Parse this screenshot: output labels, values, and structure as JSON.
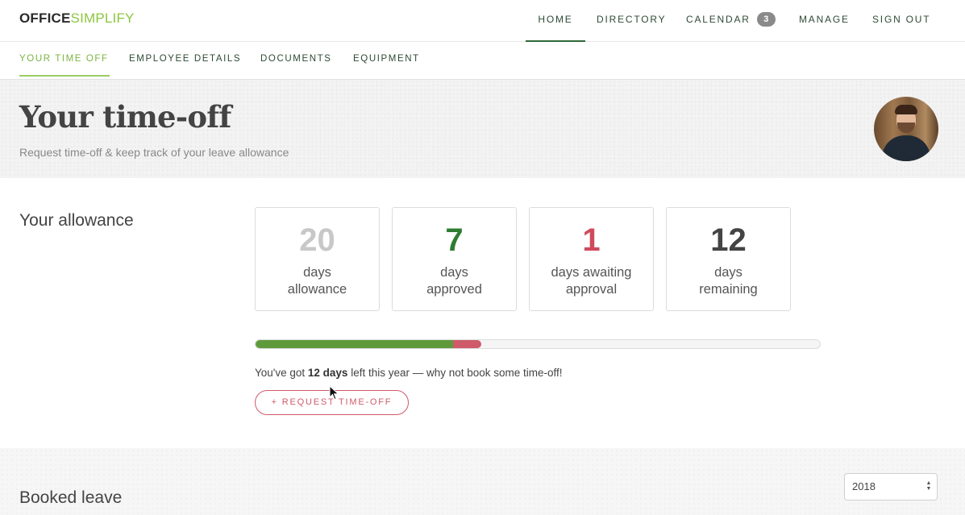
{
  "brand": {
    "part1": "OFFICE",
    "part2": "SIMPLIFY"
  },
  "main_nav": [
    {
      "label": "HOME",
      "active": true
    },
    {
      "label": "DIRECTORY"
    },
    {
      "label": "CALENDAR",
      "badge": "3"
    },
    {
      "label": "MANAGE"
    },
    {
      "label": "SIGN OUT"
    }
  ],
  "sub_nav": [
    {
      "label": "YOUR TIME OFF",
      "active": true
    },
    {
      "label": "EMPLOYEE DETAILS"
    },
    {
      "label": "DOCUMENTS"
    },
    {
      "label": "EQUIPMENT"
    }
  ],
  "header": {
    "title": "Your time-off",
    "subtitle": "Request time-off & keep track of your leave allowance"
  },
  "allowance": {
    "title": "Your allowance",
    "cards": [
      {
        "value": "20",
        "line1": "days",
        "line2": "allowance",
        "color": "#c8c8c8"
      },
      {
        "value": "7",
        "line1": "days",
        "line2": "approved",
        "color": "#2e7d32"
      },
      {
        "value": "1",
        "line1": "days awaiting",
        "line2": "approval",
        "color": "#d04a5c"
      },
      {
        "value": "12",
        "line1": "days",
        "line2": "remaining",
        "color": "#444444"
      }
    ],
    "progress": {
      "approved_fraction": 0.35,
      "pending_fraction": 0.05
    },
    "message_prefix": "You've got ",
    "message_bold": "12 days",
    "message_suffix": " left this year — why not book some time-off!",
    "request_button": "+ REQUEST TIME-OFF"
  },
  "booked": {
    "title": "Booked leave",
    "year": "2018"
  },
  "colors": {
    "brand_green": "#8cc63f",
    "nav_text": "#2d4a34",
    "accent_red": "#d05a6a",
    "approved_green": "#5f9a3a"
  }
}
